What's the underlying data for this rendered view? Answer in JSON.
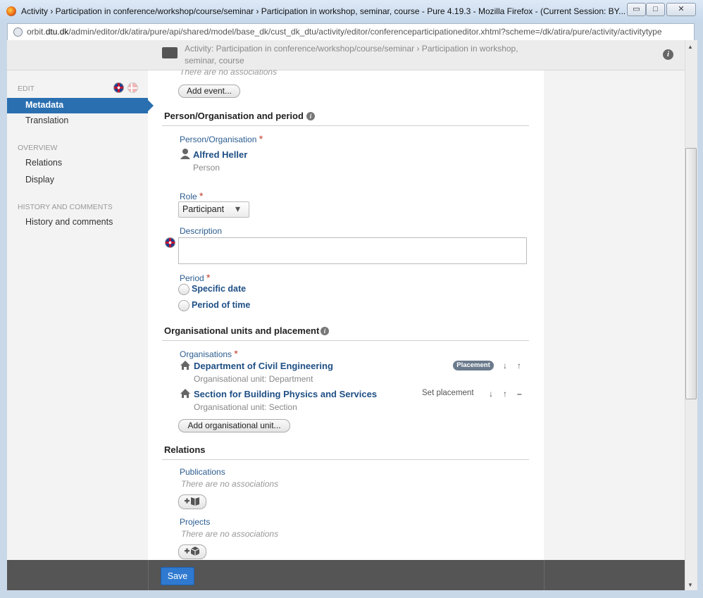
{
  "window": {
    "title": "Activity › Participation in conference/workshop/course/seminar › Participation in workshop, seminar, course - Pure 4.19.3 - Mozilla Firefox - (Current Session: BY...",
    "url_prefix": "orbit.",
    "url_host": "dtu.dk",
    "url_path": "/admin/editor/dk/atira/pure/api/shared/model/base_dk/cust_dk_dtu/activity/editor/conferenceparticipationeditor.xhtml?scheme=/dk/atira/pure/activity/activitytype",
    "minimize": "▭",
    "maximize": "□",
    "close": "✕"
  },
  "header": {
    "title": "Activity: Participation in conference/workshop/course/seminar › Participation in workshop, seminar, course",
    "info": "i"
  },
  "sidebar": {
    "edit_label": "EDIT",
    "items_edit": [
      "Metadata",
      "Translation"
    ],
    "overview_label": "OVERVIEW",
    "items_overview": [
      "Relations",
      "Display"
    ],
    "history_label": "HISTORY AND COMMENTS",
    "items_history": [
      "History and comments"
    ]
  },
  "events": {
    "empty_text": "There are no associations",
    "add_button": "Add event..."
  },
  "person_section": {
    "title": "Person/Organisation and period",
    "person_label": "Person/Organisation",
    "person_name": "Alfred Heller",
    "person_type": "Person",
    "role_label": "Role",
    "role_value": "Participant",
    "description_label": "Description",
    "description_value": "",
    "period_label": "Period",
    "period_options": [
      "Specific date",
      "Period of time"
    ]
  },
  "org_section": {
    "title": "Organisational units and placement",
    "organisations_label": "Organisations",
    "orgs": [
      {
        "name": "Department of Civil Engineering",
        "type": "Organisational unit: Department",
        "placement": "Placement"
      },
      {
        "name": "Section for Building Physics and Services",
        "type": "Organisational unit: Section",
        "placement": "Set placement"
      }
    ],
    "add_button": "Add organisational unit..."
  },
  "relations": {
    "title": "Relations",
    "publications_label": "Publications",
    "publications_empty": "There are no associations",
    "projects_label": "Projects",
    "projects_empty": "There are no associations"
  },
  "footer": {
    "save": "Save"
  },
  "glyphs": {
    "required": "*",
    "down": "↓",
    "up": "↑",
    "remove": "–",
    "caret": "▾"
  },
  "colors": {
    "accent": "#2a6fb0",
    "link": "#1e4f85",
    "required": "#c0392b"
  }
}
